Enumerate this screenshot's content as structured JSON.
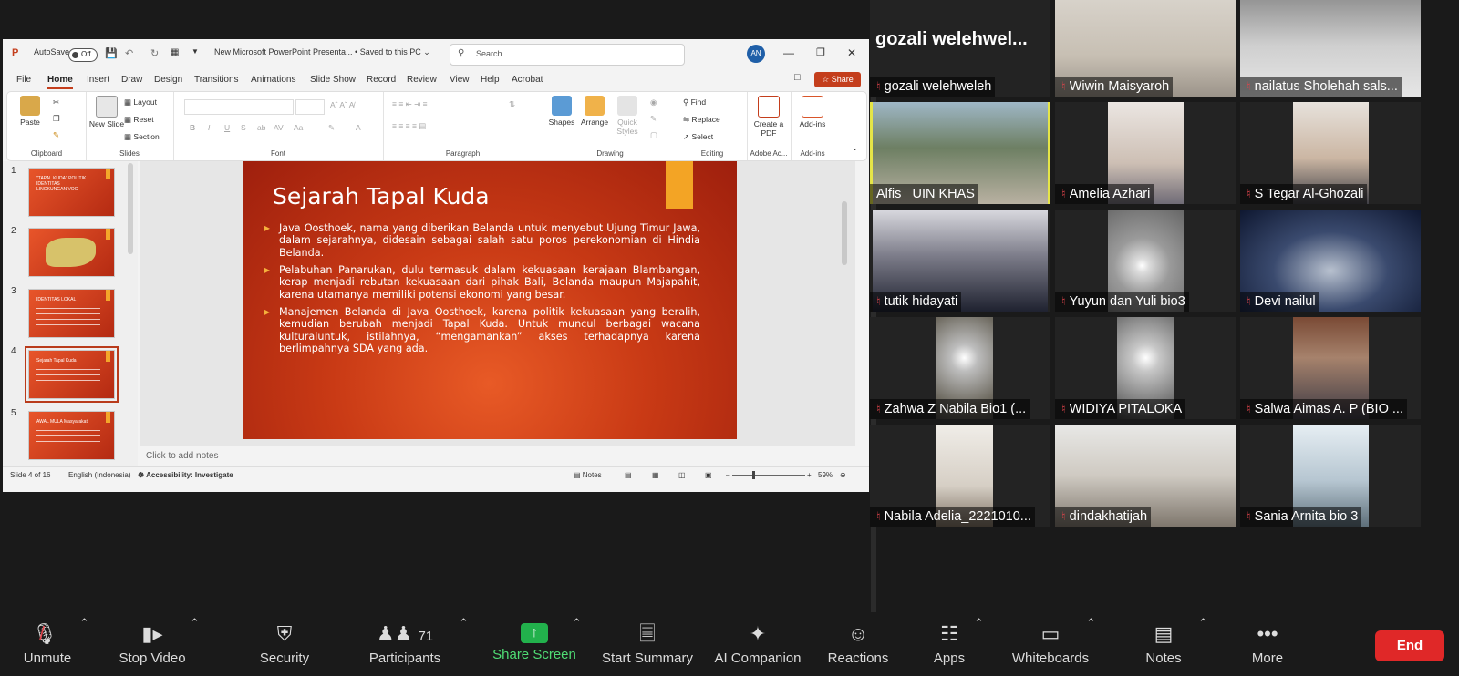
{
  "powerpoint": {
    "autosave_label": "AutoSave",
    "autosave_state": "Off",
    "doc_title": "New Microsoft PowerPoint Presenta... • Saved to this PC ⌄",
    "search_placeholder": "Search",
    "user_initials": "AN",
    "tabs": [
      "File",
      "Home",
      "Insert",
      "Draw",
      "Design",
      "Transitions",
      "Animations",
      "Slide Show",
      "Record",
      "Review",
      "View",
      "Help",
      "Acrobat"
    ],
    "active_tab": "Home",
    "share_label": "Share",
    "ribbon": {
      "clipboard": {
        "label": "Clipboard",
        "paste": "Paste"
      },
      "slides": {
        "label": "Slides",
        "new_slide": "New Slide",
        "layout": "Layout",
        "reset": "Reset",
        "section": "Section"
      },
      "font": {
        "label": "Font"
      },
      "paragraph": {
        "label": "Paragraph"
      },
      "drawing": {
        "label": "Drawing",
        "shapes": "Shapes",
        "arrange": "Arrange",
        "quick_styles": "Quick Styles"
      },
      "editing": {
        "label": "Editing",
        "find": "Find",
        "replace": "Replace",
        "select": "Select"
      },
      "adobe": {
        "label": "Adobe Ac...",
        "create_pdf": "Create a PDF"
      },
      "addins": {
        "label": "Add-ins",
        "addins": "Add-ins"
      }
    },
    "thumbnails": [
      {
        "num": "1",
        "title": "\"TAPAL KUDA\" POLITIK IDENTITAS LINGKUNGAN VOC"
      },
      {
        "num": "2",
        "title": ""
      },
      {
        "num": "3",
        "title": "IDENTITAS LOKAL"
      },
      {
        "num": "4",
        "title": "Sejarah Tapal Kuda"
      },
      {
        "num": "5",
        "title": "AWAL MULA Masyarakat"
      }
    ],
    "slide": {
      "title": "Sejarah Tapal Kuda",
      "bullets": [
        "Java Oosthoek, nama yang diberikan Belanda untuk menyebut Ujung Timur Jawa, dalam sejarahnya, didesain sebagai salah satu poros perekonomian di Hindia Belanda.",
        "Pelabuhan Panarukan, dulu termasuk dalam kekuasaan kerajaan Blambangan, kerap menjadi rebutan kekuasaan dari pihak Bali, Belanda maupun Majapahit, karena utamanya memiliki potensi ekonomi yang besar.",
        "Manajemen Belanda di Java Oosthoek, karena politik kekuasaan yang beralih, kemudian berubah menjadi Tapal Kuda. Untuk muncul berbagai wacana kulturaluntuk, istilahnya, “mengamankan” akses terhadapnya karena berlimpahnya SDA yang ada."
      ]
    },
    "notes_placeholder": "Click to add notes",
    "status": {
      "slide_of": "Slide 4 of 16",
      "language": "English (Indonesia)",
      "accessibility": "Accessibility: Investigate",
      "notes": "Notes",
      "zoom": "59%"
    }
  },
  "gallery": {
    "featured_name": "gozali  welehwel...",
    "participants": [
      {
        "name": "gozali welehweleh",
        "muted": true
      },
      {
        "name": "Wiwin Maisyaroh",
        "muted": true
      },
      {
        "name": "nailatus Sholehah sals...",
        "muted": true
      },
      {
        "name": "Alfis_ UIN KHAS",
        "muted": false,
        "active_speaker": true
      },
      {
        "name": "Amelia Azhari",
        "muted": true
      },
      {
        "name": "S Tegar Al-Ghozali",
        "muted": true
      },
      {
        "name": "tutik hidayati",
        "muted": true
      },
      {
        "name": "Yuyun dan Yuli bio3",
        "muted": true
      },
      {
        "name": "Devi nailul",
        "muted": true
      },
      {
        "name": "Zahwa Z Nabila Bio1 (...",
        "muted": true
      },
      {
        "name": "WIDIYA PITALOKA",
        "muted": true
      },
      {
        "name": "Salwa Aimas A. P (BIO ...",
        "muted": true
      },
      {
        "name": "Nabila Adelia_2221010...",
        "muted": true
      },
      {
        "name": "dindakhatijah",
        "muted": true
      },
      {
        "name": "Sania Arnita bio 3",
        "muted": true
      }
    ]
  },
  "toolbar": {
    "unmute": "Unmute",
    "stop_video": "Stop Video",
    "security": "Security",
    "participants": "Participants",
    "participants_count": "71",
    "share_screen": "Share Screen",
    "start_summary": "Start Summary",
    "ai_companion": "AI Companion",
    "reactions": "Reactions",
    "apps": "Apps",
    "whiteboards": "Whiteboards",
    "notes": "Notes",
    "more": "More",
    "end": "End"
  },
  "colors": {
    "accent_share": "#22b14c",
    "end_button": "#e02828",
    "active_speaker": "#e5e547",
    "muted_icon": "#e0444b",
    "ppt_accent": "#c43e1c"
  }
}
